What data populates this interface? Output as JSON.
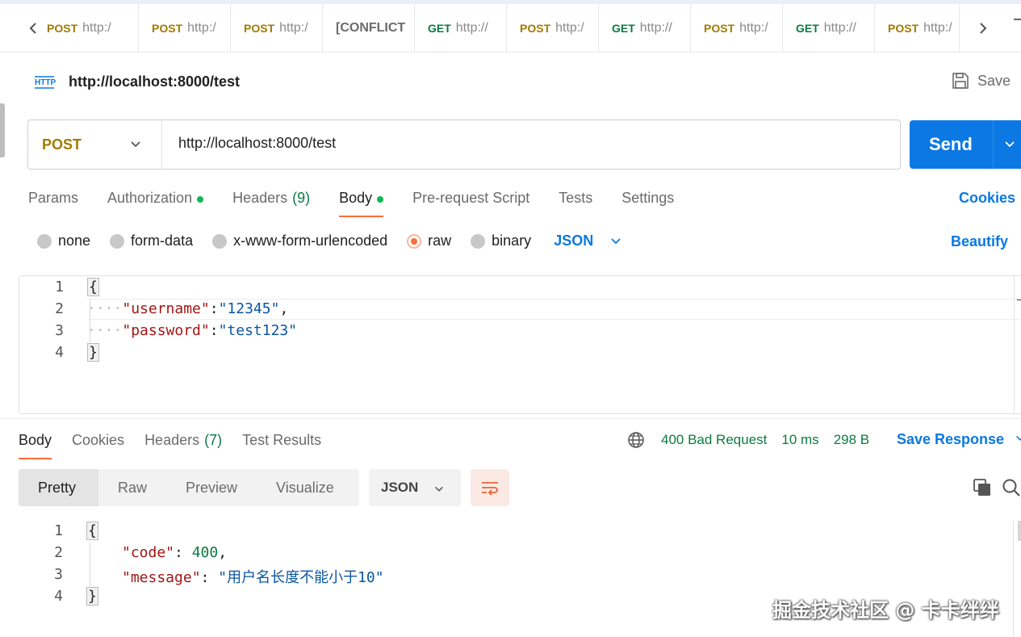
{
  "tabs": [
    {
      "method": "POST",
      "url": "http:/",
      "partial": true
    },
    {
      "method": "POST",
      "url": "http:/"
    },
    {
      "method": "POST",
      "url": "http:/"
    },
    {
      "method": "",
      "url": "[CONFLICT"
    },
    {
      "method": "GET",
      "url": "http://"
    },
    {
      "method": "POST",
      "url": "http:/"
    },
    {
      "method": "GET",
      "url": "http://"
    },
    {
      "method": "POST",
      "url": "http:/"
    },
    {
      "method": "GET",
      "url": "http://"
    },
    {
      "method": "POST",
      "url": "http:/"
    }
  ],
  "request": {
    "title": "http://localhost:8000/test",
    "save_label": "Save",
    "method": "POST",
    "url": "http://localhost:8000/test",
    "send_label": "Send"
  },
  "request_tabs": {
    "params": "Params",
    "authorization": "Authorization",
    "headers": "Headers",
    "headers_count": "(9)",
    "body": "Body",
    "prerequest": "Pre-request Script",
    "tests": "Tests",
    "settings": "Settings",
    "cookies": "Cookies"
  },
  "body_types": {
    "none": "none",
    "form_data": "form-data",
    "urlencoded": "x-www-form-urlencoded",
    "raw": "raw",
    "binary": "binary",
    "format": "JSON",
    "beautify": "Beautify",
    "selected": "raw"
  },
  "request_body": {
    "line_numbers": [
      "1",
      "2",
      "3",
      "4"
    ],
    "open": "{",
    "close": "}",
    "k1": "\"username\"",
    "v1": "\"12345\"",
    "k2": "\"password\"",
    "v2": "\"test123\""
  },
  "response_tabs": {
    "body": "Body",
    "cookies": "Cookies",
    "headers": "Headers",
    "headers_count": "(7)",
    "test_results": "Test Results"
  },
  "response_status": {
    "status": "400 Bad Request",
    "time": "10 ms",
    "size": "298 B",
    "save_response": "Save Response"
  },
  "response_views": {
    "pretty": "Pretty",
    "raw": "Raw",
    "preview": "Preview",
    "visualize": "Visualize",
    "format": "JSON"
  },
  "response_body": {
    "line_numbers": [
      "1",
      "2",
      "3",
      "4"
    ],
    "open": "{",
    "close": "}",
    "k1": "\"code\"",
    "v1": "400",
    "k2": "\"message\"",
    "v2": "\"用户名长度不能小于10\""
  },
  "watermark": "掘金技术社区 @ 卡卡绊绊",
  "colors": {
    "accent_blue": "#0b78e3",
    "post_color": "#a17a00",
    "get_color": "#0c7a43",
    "active_underline": "#ff6c37",
    "status_green": "#0c7a43"
  }
}
